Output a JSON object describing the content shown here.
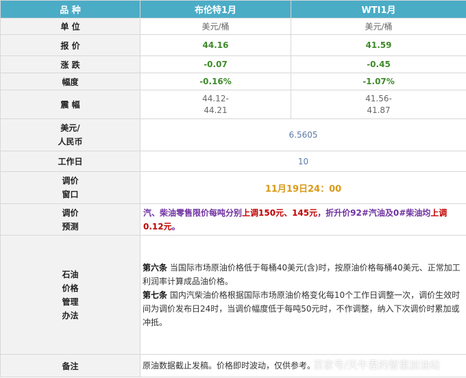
{
  "header": {
    "col0": "品  种",
    "col1": "布伦特1月",
    "col2": "WTI1月"
  },
  "rows": {
    "unit": {
      "label": "单 位",
      "brent": "美元/桶",
      "wti": "美元/桶"
    },
    "price": {
      "label": "报 价",
      "brent": "44.16",
      "wti": "41.59"
    },
    "change": {
      "label": "涨 跌",
      "brent": "-0.07",
      "wti": "-0.45"
    },
    "pct": {
      "label": "幅度",
      "brent": "-0.16%",
      "wti": "-1.07%"
    },
    "range": {
      "label": "震 幅",
      "brent_line1": "44.12-",
      "brent_line2": "44.21",
      "wti_line1": "41.56-",
      "wti_line2": "41.87"
    },
    "fx": {
      "label_line1": "美元/",
      "label_line2": "人民币",
      "value": "6.5605"
    },
    "workdays": {
      "label": "工作日",
      "value": "10"
    },
    "window": {
      "label_line1": "调价",
      "label_line2": "窗口",
      "value": "11月19日24：00"
    },
    "forecast": {
      "label_line1": "调价",
      "label_line2": "预测",
      "p1": "汽、柴油零售限价每吨分别",
      "p2": "上调150元、145元",
      "p3": "，折升价92#汽油及0#柴油均",
      "p4": "上调0.12元",
      "p5": "。"
    },
    "rules": {
      "label_line1": "石油",
      "label_line2": "价格",
      "label_line3": "管理",
      "label_line4": "办法",
      "art6_title": "第六条",
      "art6_text": "  当国际市场原油价格低于每桶40美元(含)时，按原油价格每桶40美元、正常加工利润率计算成品油价格。",
      "art7_title": "第七条",
      "art7_text": "  国内汽柴油价格根据国际市场原油价格变化每10个工作日调整一次，调价生效时间为调价发布日24时，当调价幅度低于每吨50元时，不作调整，纳入下次调价时累加或冲抵。"
    },
    "remark": {
      "label": "备注",
      "value": "原油数据截止发稿。价格即时波动，仅供参考。"
    }
  },
  "watermark": "百家号/天牛君的智惠加油站",
  "colors": {
    "header_bg": "#4bacc6",
    "label_bg": "#f2f2f2",
    "value_green": "#3e8a2a",
    "purple": "#7030a0",
    "red": "#c00000",
    "gold": "#d99a18"
  }
}
